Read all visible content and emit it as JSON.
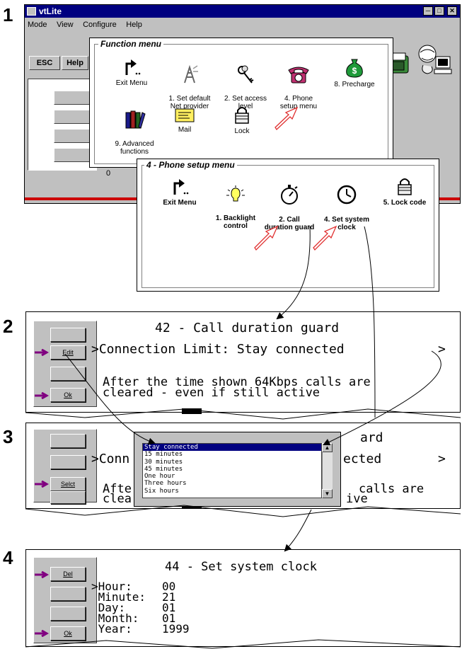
{
  "steps": [
    "1",
    "2",
    "3",
    "4"
  ],
  "window": {
    "title": "vtLite",
    "menu": [
      "Mode",
      "View",
      "Configure",
      "Help"
    ],
    "toolbar": {
      "esc": "ESC",
      "help": "Help"
    },
    "status_value": "0"
  },
  "function_menu": {
    "title": "Function menu",
    "items": [
      {
        "label": "Exit Menu",
        "icon": "exit-arrow-icon"
      },
      {
        "label": "1.  Set default\nNet provider",
        "icon": "network-tower-icon"
      },
      {
        "label": "2. Set access\nlevel",
        "icon": "keys-icon"
      },
      {
        "label": "4.  Phone\nsetup menu",
        "icon": "telephone-icon"
      },
      {
        "label": "8.  Precharge",
        "icon": "money-bag-icon"
      },
      {
        "label": "9.  Advanced\nfunctions",
        "icon": "books-icon"
      },
      {
        "label": "Mail",
        "icon": "mail-envelope-icon"
      },
      {
        "label": "Lock",
        "icon": "padlock-icon"
      }
    ]
  },
  "phone_menu": {
    "title": "4 - Phone setup menu",
    "items": [
      {
        "label": "Exit Menu",
        "icon": "exit-arrow-icon"
      },
      {
        "label": "1.  Backlight\ncontrol",
        "icon": "light-bulb-icon"
      },
      {
        "label": "2.  Call\nduration guard",
        "icon": "stopwatch-icon"
      },
      {
        "label": "4.  Set system\nclock",
        "icon": "clock-icon"
      },
      {
        "label": "5.  Lock code",
        "icon": "lock-code-icon"
      }
    ]
  },
  "panel2": {
    "title": "42 - Call duration guard",
    "line1": ">Connection Limit: Stay connected",
    "next": ">",
    "desc1": "After the time shown 64Kbps calls are",
    "desc2": "cleared - even if still active",
    "btn_edit": "Edit",
    "btn_ok": "Ok"
  },
  "panel3": {
    "title_frag": "ard",
    "line_left": ">Conn",
    "line_right": "ected",
    "next": ">",
    "desc_left1": "Afte",
    "desc_left2": "clea",
    "desc_right1": "calls are",
    "desc_right2": "ive",
    "btn_select": "Selct",
    "options": [
      "Stay connected",
      "15 minutes",
      "30 minutes",
      "45 minutes",
      "One hour",
      "Three hours",
      "Six hours"
    ],
    "selected": "Stay connected"
  },
  "panel4": {
    "title": "44 - Set system clock",
    "fields": [
      {
        "label": ">Hour:",
        "value": "00"
      },
      {
        "label": " Minute:",
        "value": "21"
      },
      {
        "label": " Day:",
        "value": "01"
      },
      {
        "label": " Month:",
        "value": "01"
      },
      {
        "label": " Year:",
        "value": "1999"
      }
    ],
    "btn_del": "Del",
    "btn_ok": "Ok"
  },
  "colors": {
    "titlebar": "#000080",
    "accent_red": "#cc0000",
    "arrow": "#800080"
  }
}
